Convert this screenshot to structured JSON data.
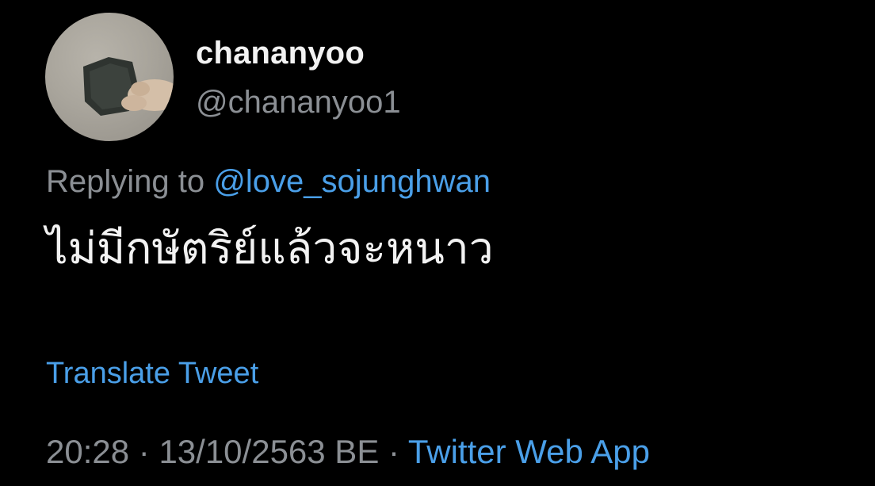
{
  "author": {
    "display_name": "chananyoo",
    "handle": "@chananyoo1"
  },
  "reply": {
    "prefix": "Replying to",
    "mention": "@love_sojunghwan"
  },
  "tweet": {
    "text": "ไม่มีกษัตริย์แล้วจะหนาว",
    "translate_label": "Translate Tweet"
  },
  "meta": {
    "time": "20:28",
    "separator1": " · ",
    "date": "13/10/2563 BE",
    "separator2": " · ",
    "source": "Twitter Web App"
  },
  "colors": {
    "background": "#000000",
    "link": "#4a9fe8",
    "muted": "#8b8f94",
    "text": "#f2f2f2"
  }
}
